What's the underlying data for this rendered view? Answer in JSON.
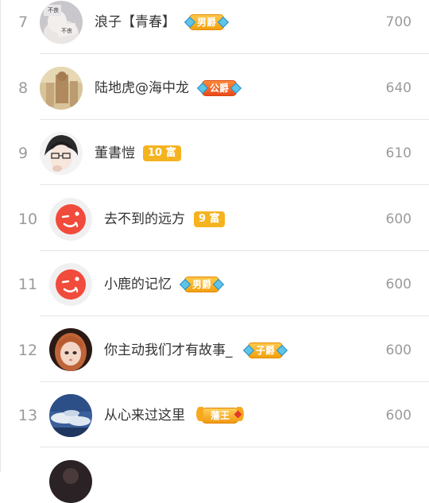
{
  "leaderboard": {
    "rows": [
      {
        "rank": "7",
        "name": "浪子【青春】",
        "badge": "男爵",
        "score": "700"
      },
      {
        "rank": "8",
        "name": "陆地虎@海中龙",
        "badge": "公爵",
        "score": "640"
      },
      {
        "rank": "9",
        "name": "董書愷",
        "badge": "10 富",
        "score": "610"
      },
      {
        "rank": "10",
        "name": "去不到的远方",
        "badge": "9 富",
        "score": "600"
      },
      {
        "rank": "11",
        "name": "小鹿的记忆",
        "badge": "男爵",
        "score": "600"
      },
      {
        "rank": "12",
        "name": "你主动我们才有故事_",
        "badge": "子爵",
        "score": "600"
      },
      {
        "rank": "13",
        "name": "从心来过这里",
        "badge": "藩王",
        "score": "600"
      }
    ]
  }
}
